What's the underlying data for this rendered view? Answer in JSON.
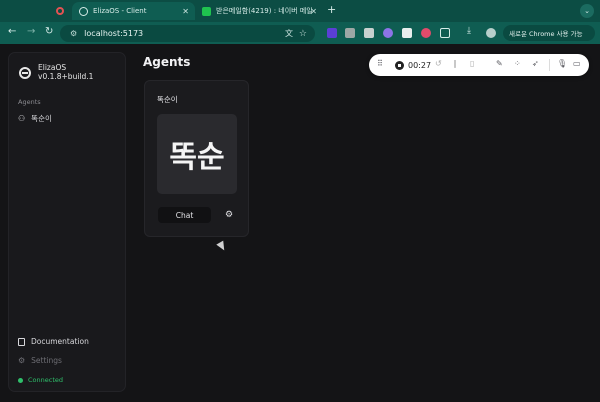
{
  "browser": {
    "tabs": [
      {
        "title": "ElizaOS - Client",
        "active": true
      },
      {
        "title": "받은메일함(4219) : 네이버 메일",
        "active": false
      }
    ],
    "address": "localhost:5173",
    "chrome_button_label": "새로운 Chrome 사용 가능"
  },
  "sidebar": {
    "brand_name": "ElizaOS",
    "version": "v0.1.8+build.1",
    "section_label": "Agents",
    "agents": [
      {
        "label": "똑순이"
      }
    ],
    "documentation_label": "Documentation",
    "settings_label": "Settings",
    "status_label": "Connected"
  },
  "main": {
    "title": "Agents",
    "card": {
      "name": "똑순이",
      "avatar_text": "똑순",
      "chat_label": "Chat"
    }
  },
  "recorder": {
    "time": "00:27"
  },
  "colors": {
    "tabbar": "#0c4d44",
    "toolbar": "#0f5d52",
    "background": "#141416",
    "status_green": "#2fbf6b"
  },
  "icons": [
    "elizaos-logo-icon",
    "user-icon",
    "book-icon",
    "gear-icon",
    "back-icon",
    "forward-icon",
    "reload-icon",
    "star-icon",
    "translate-icon",
    "download-icon",
    "stop-icon",
    "mic-icon",
    "camera-icon",
    "pen-icon",
    "grid-icon",
    "pointer-icon",
    "drag-handle-icon",
    "restart-icon",
    "pause-icon",
    "trash-icon"
  ]
}
